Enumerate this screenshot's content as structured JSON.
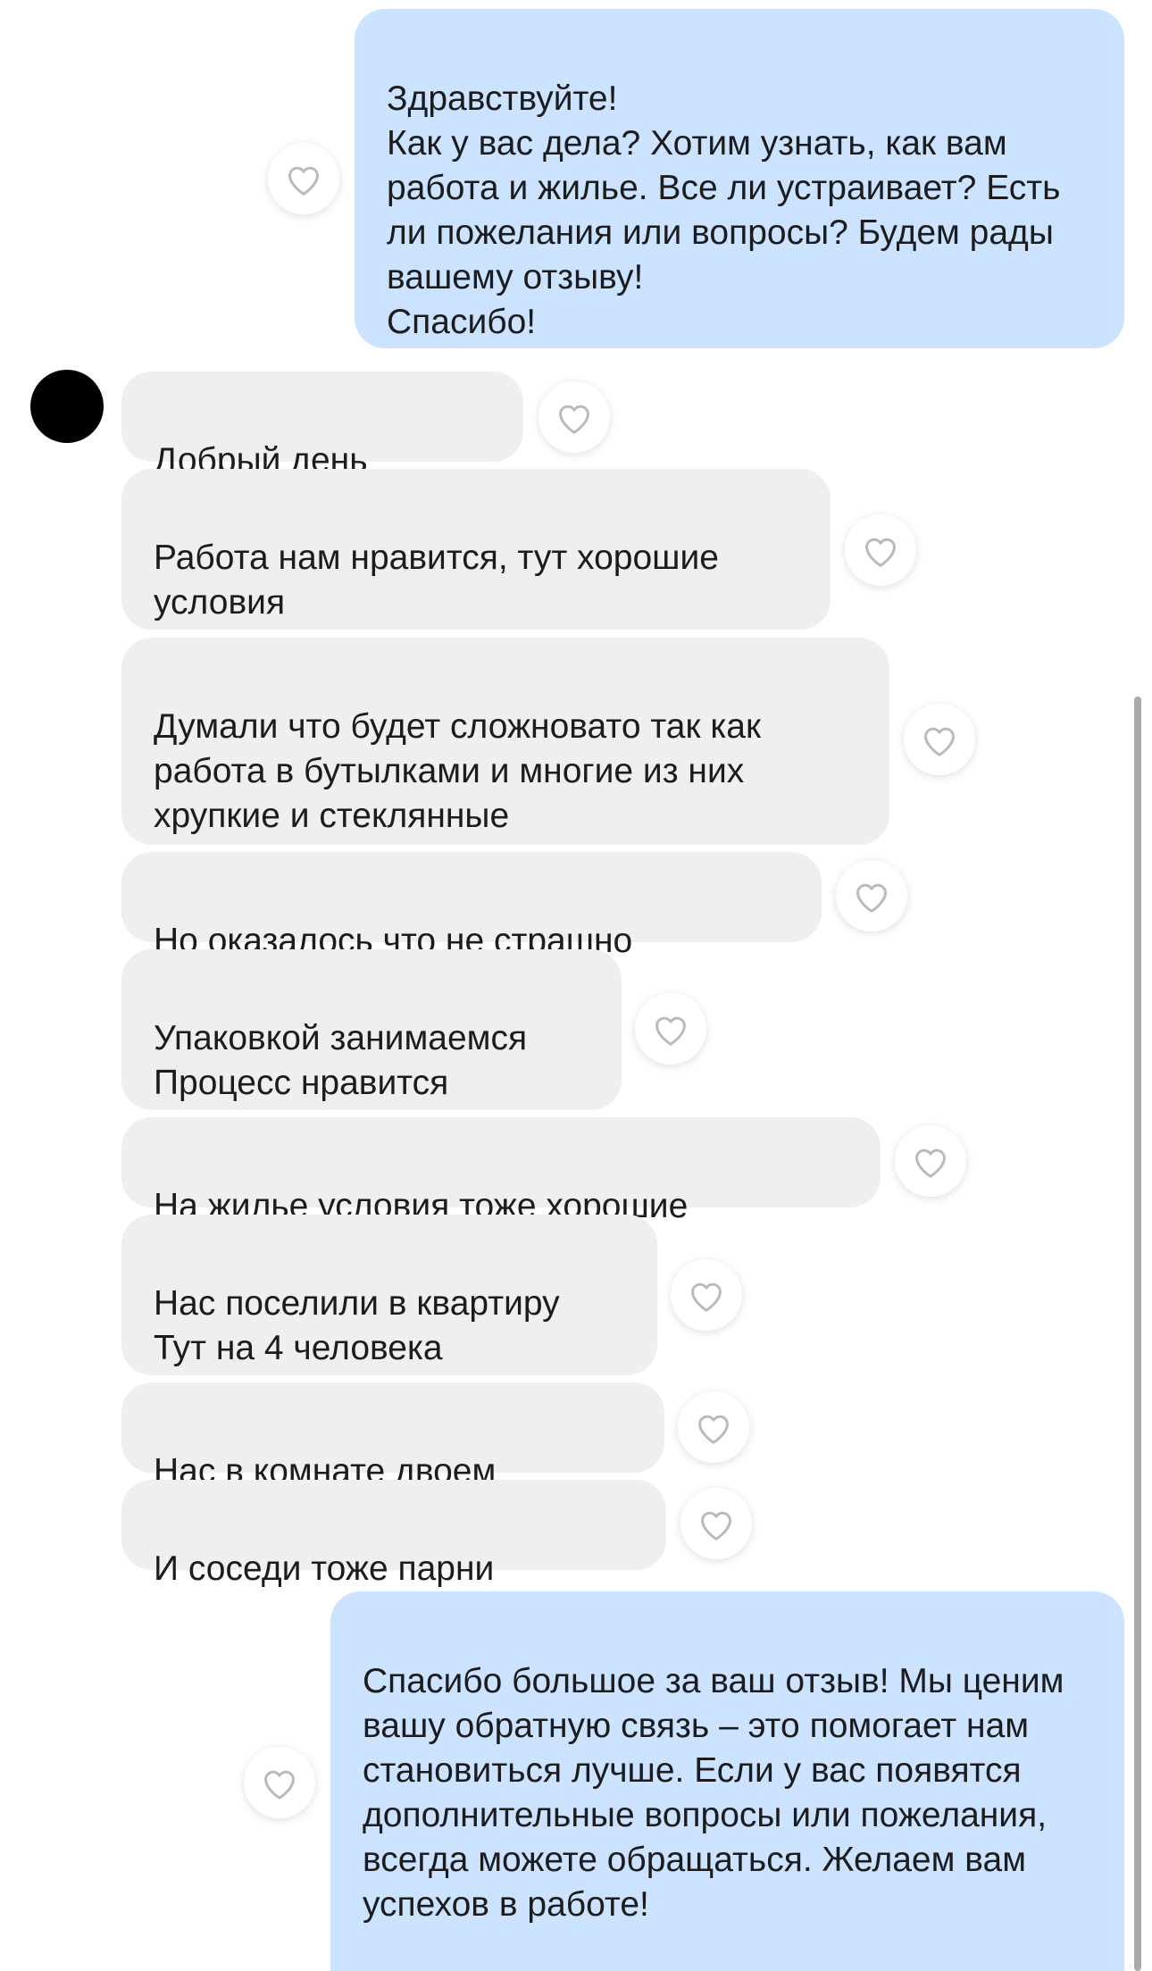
{
  "chat": {
    "messages": [
      {
        "id": "m1",
        "direction": "outgoing",
        "text": "Здравствуйте!\nКак у вас дела? Хотим узнать, как вам работа и жилье. Все ли устраивает? Есть ли пожелания или вопросы? Будем рады вашему отзыву!\nСпасибо!"
      },
      {
        "id": "m2",
        "direction": "incoming",
        "text": "Добрый день"
      },
      {
        "id": "m3",
        "direction": "incoming",
        "text": "Работа нам нравится, тут хорошие условия"
      },
      {
        "id": "m4",
        "direction": "incoming",
        "text": "Думали что будет сложновато так как работа в бутылками и многие  из них хрупкие и стеклянные"
      },
      {
        "id": "m5",
        "direction": "incoming",
        "text": "Но оказалось что не страшно"
      },
      {
        "id": "m6",
        "direction": "incoming",
        "text": "Упаковкой занимаемся\nПроцесс нравится"
      },
      {
        "id": "m7",
        "direction": "incoming",
        "text": "На жилье условия тоже хорошие"
      },
      {
        "id": "m8",
        "direction": "incoming",
        "text": "Нас поселили в квартиру\nТут на 4 человека"
      },
      {
        "id": "m9",
        "direction": "incoming",
        "text": "Нас в комнате двоем"
      },
      {
        "id": "m10",
        "direction": "incoming",
        "text": "И соседи тоже парни"
      },
      {
        "id": "m11",
        "direction": "outgoing",
        "text": "Спасибо большое за ваш отзыв! Мы ценим вашу обратную связь – это помогает нам становиться лучше. Если у вас появятся дополнительные вопросы или пожелания, всегда можете обращаться. Желаем вам успехов в работе!"
      }
    ]
  },
  "icons": {
    "like": "heart-outline-icon",
    "avatar": "avatar-redacted"
  },
  "colors": {
    "outgoing_bubble": "#cbe3ff",
    "incoming_bubble": "#efeff1",
    "heart_stroke": "#b8b8bd"
  }
}
